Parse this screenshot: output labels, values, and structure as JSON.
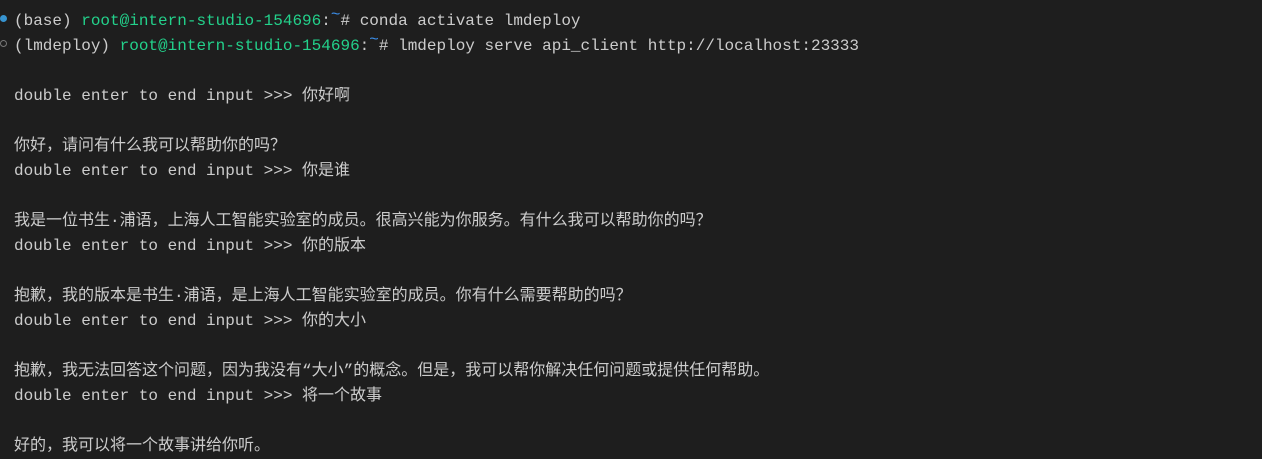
{
  "terminal": {
    "colors": {
      "background": "#1e1e1e",
      "text": "#cccccc",
      "prompt_green": "#23d18b",
      "tilde_blue": "#3b8eea"
    },
    "commands": [
      {
        "env": "(base) ",
        "user_host": "root@intern-studio-154696",
        "sep": ":",
        "path": "~",
        "symbol": "# ",
        "command": "conda activate lmdeploy",
        "status": "success"
      },
      {
        "env": "(lmdeploy) ",
        "user_host": "root@intern-studio-154696",
        "sep": ":",
        "path": "~",
        "symbol": "# ",
        "command": "lmdeploy serve api_client http://localhost:23333",
        "status": "running"
      }
    ],
    "prompt_label": "double enter to end input >>> ",
    "exchanges": [
      {
        "input": "你好啊",
        "reply": "你好，请问有什么我可以帮助你的吗？"
      },
      {
        "input": "你是谁",
        "reply": "我是一位书生·浦语，上海人工智能实验室的成员。很高兴能为你服务。有什么我可以帮助你的吗？"
      },
      {
        "input": "你的版本",
        "reply": "抱歉，我的版本是书生·浦语，是上海人工智能实验室的成员。你有什么需要帮助的吗？"
      },
      {
        "input": "你的大小",
        "reply": "抱歉，我无法回答这个问题，因为我没有“大小”的概念。但是，我可以帮你解决任何问题或提供任何帮助。"
      },
      {
        "input": "将一个故事",
        "reply": "好的，我可以将一个故事讲给你听。"
      }
    ]
  }
}
